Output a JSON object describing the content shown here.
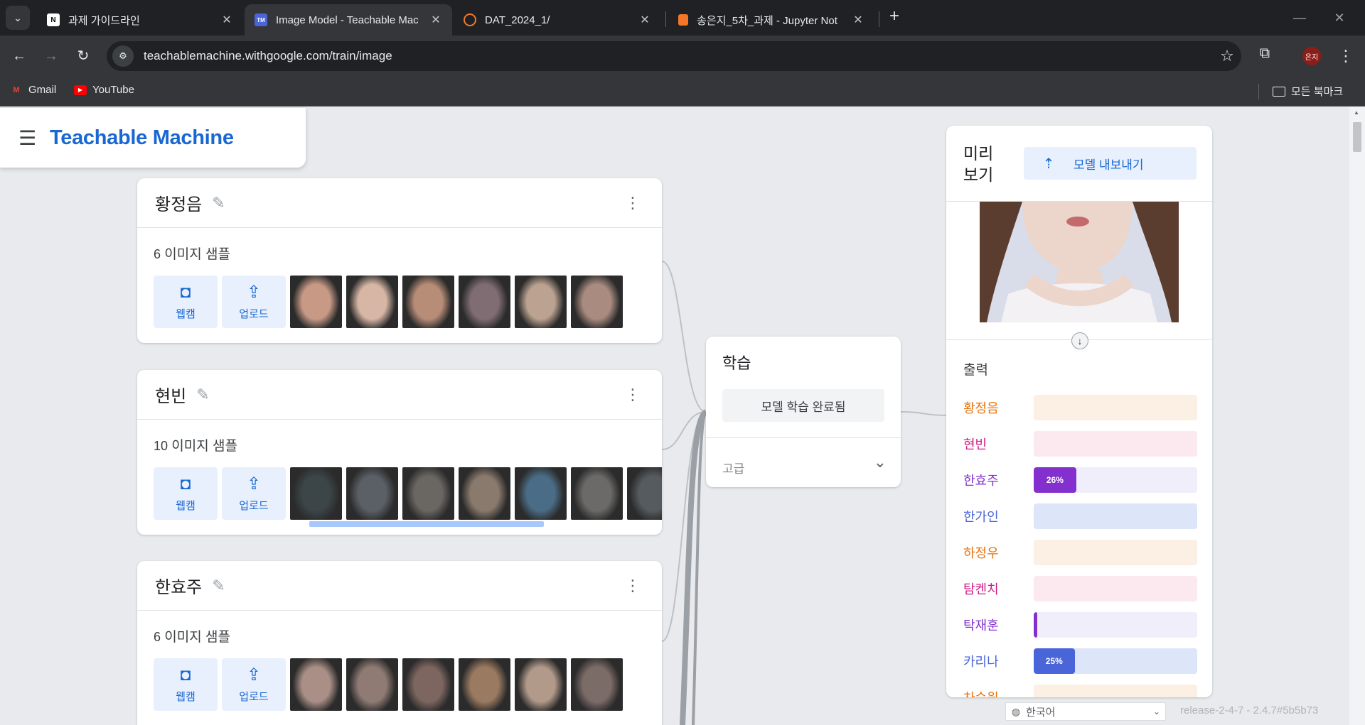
{
  "browser": {
    "tabs": [
      {
        "title": "과제 가이드라인",
        "favicon": "notion-icon",
        "active": false
      },
      {
        "title": "Image Model - Teachable Mac",
        "favicon": "tm-icon",
        "active": true
      },
      {
        "title": "DAT_2024_1/",
        "favicon": "jupyter-icon",
        "active": false
      },
      {
        "title": "송은지_5차_과제 - Jupyter Not",
        "favicon": "notebook-icon",
        "active": false
      }
    ],
    "favicon_labels": {
      "notion": "N",
      "tm": "TM"
    },
    "url": "teachablemachine.withgoogle.com/train/image",
    "profile_initials": "은지",
    "bookmarks": [
      {
        "label": "Gmail",
        "icon": "gmail-icon"
      },
      {
        "label": "YouTube",
        "icon": "youtube-icon"
      }
    ],
    "all_bookmarks_label": "모든 북마크"
  },
  "app": {
    "brand": "Teachable Machine",
    "add_buttons": {
      "webcam": "웹캠",
      "upload": "업로드"
    },
    "classes": [
      {
        "name": "황정음",
        "count": "6",
        "samples_label": " 이미지 샘플",
        "thumbs": [
          "#c89a86",
          "#d8b6a5",
          "#b88d78",
          "#7f6d73",
          "#bca290",
          "#a98b7f"
        ]
      },
      {
        "name": "현빈",
        "count": "10",
        "samples_label": " 이미지 샘플",
        "thumbs": [
          "#3c4548",
          "#5b6066",
          "#6a6762",
          "#8a7a6d",
          "#4a6c86",
          "#6b6a68",
          "#555b5f"
        ]
      },
      {
        "name": "한효주",
        "count": "6",
        "samples_label": " 이미지 샘플",
        "thumbs": [
          "#a98f86",
          "#8f7b74",
          "#7e6660",
          "#9a7a60",
          "#b29a8a",
          "#7c6c68"
        ]
      }
    ],
    "train": {
      "title": "학습",
      "button": "모델 학습 완료됨",
      "advanced": "고급"
    },
    "preview": {
      "title": "미리 보기",
      "export_button": "모델 내보내기",
      "output_label": "출력",
      "outputs": [
        {
          "name": "황정음",
          "value": 0,
          "label": "",
          "color": "#e8710a",
          "track": "#fcefe3"
        },
        {
          "name": "현빈",
          "value": 0,
          "label": "",
          "color": "#d01884",
          "track": "#fbe9ef"
        },
        {
          "name": "한효주",
          "value": 0.26,
          "label": "26%",
          "color": "#8430ce",
          "track": "#f1eefb"
        },
        {
          "name": "한가인",
          "value": 0,
          "label": "",
          "color": "#4a65d8",
          "track": "#dde5f9"
        },
        {
          "name": "하정우",
          "value": 0,
          "label": "",
          "color": "#e8710a",
          "track": "#fcefe3"
        },
        {
          "name": "탐켄치",
          "value": 0,
          "label": "",
          "color": "#d01884",
          "track": "#fbe9ef"
        },
        {
          "name": "탁재훈",
          "value": 0.02,
          "label": "",
          "color": "#8430ce",
          "track": "#f1eefb"
        },
        {
          "name": "카리나",
          "value": 0.25,
          "label": "25%",
          "color": "#4a65d8",
          "track": "#dde5f9"
        },
        {
          "name": "차승원",
          "value": 0,
          "label": "",
          "color": "#e8710a",
          "track": "#fcefe3"
        }
      ]
    },
    "language": "한국어",
    "release": "release-2-4-7 - 2.4.7#5b5b73"
  }
}
